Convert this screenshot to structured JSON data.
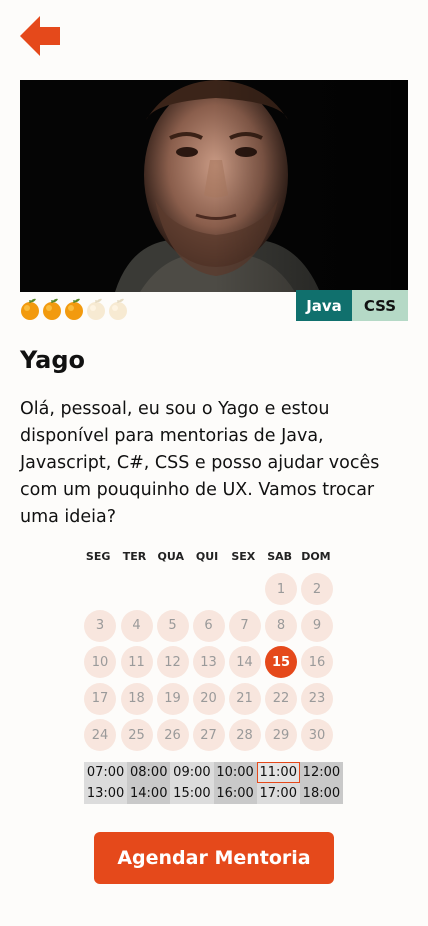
{
  "icons": {
    "back": "arrow-left-icon",
    "rating": "orange-icon"
  },
  "colors": {
    "accent": "#e5491b",
    "java_tag": "#10706d",
    "css_tag": "#b5d9c6",
    "day_bg": "#f8e6de"
  },
  "mentor": {
    "name": "Yago",
    "bio": "Olá, pessoal, eu sou o Yago e estou disponível para mentorias de Java, Javascript, C#, CSS e posso ajudar vocês com um pouquinho de UX. Vamos trocar uma ideia?",
    "rating": 3,
    "rating_max": 5,
    "tags": [
      "Java",
      "CSS"
    ]
  },
  "calendar": {
    "weekdays": [
      "SEG",
      "TER",
      "QUA",
      "QUI",
      "SEX",
      "SAB",
      "DOM"
    ],
    "weeks": [
      [
        null,
        null,
        null,
        null,
        null,
        1,
        2
      ],
      [
        3,
        4,
        5,
        6,
        7,
        8,
        9
      ],
      [
        10,
        11,
        12,
        13,
        14,
        15,
        16
      ],
      [
        17,
        18,
        19,
        20,
        21,
        22,
        23
      ],
      [
        24,
        25,
        26,
        27,
        28,
        29,
        30
      ]
    ],
    "selected_day": 15
  },
  "times": {
    "slots": [
      "07:00",
      "08:00",
      "09:00",
      "10:00",
      "11:00",
      "12:00",
      "13:00",
      "14:00",
      "15:00",
      "16:00",
      "17:00",
      "18:00"
    ],
    "selected": "11:00"
  },
  "cta": {
    "label": "Agendar Mentoria"
  }
}
